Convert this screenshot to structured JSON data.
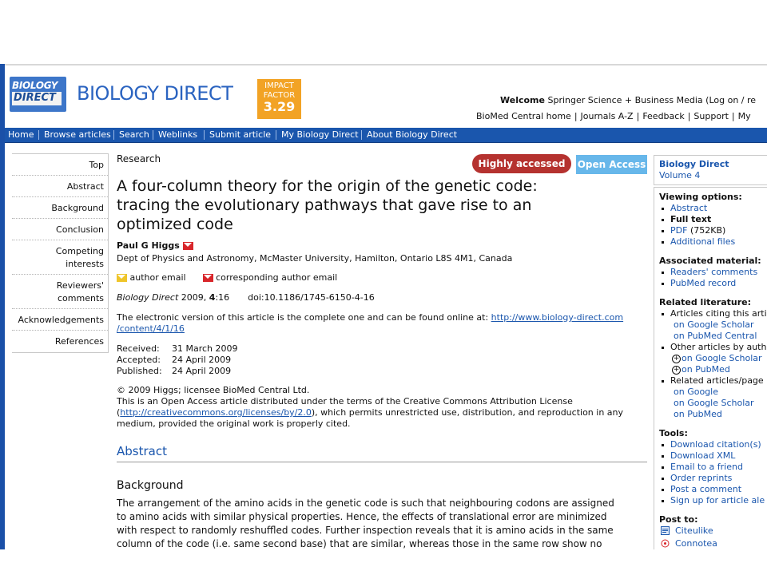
{
  "header": {
    "logo_line1": "BIOLOGY",
    "logo_line2": "DIRECT",
    "brand": "BIOLOGY DIRECT",
    "impact_line1": "IMPACT",
    "impact_line2": "FACTOR",
    "impact_value": "3.29",
    "welcome_label": "Welcome",
    "welcome_text": "Springer Science + Business Media (Log on / re",
    "top_links": [
      "BioMed Central home",
      "Journals A-Z",
      "Feedback",
      "Support",
      "My"
    ]
  },
  "navbar": [
    "Home",
    "Browse articles",
    "Search",
    "Weblinks",
    "Submit article",
    "My Biology Direct",
    "About Biology Direct"
  ],
  "leftnav": {
    "top": "Top",
    "abstract": "Abstract",
    "background": "Background",
    "conclusion": "Conclusion",
    "competing_1": "Competing",
    "competing_2": "interests",
    "reviewers_1": "Reviewers'",
    "reviewers_2": "comments",
    "acknowledgements": "Acknowledgements",
    "references": "References"
  },
  "article": {
    "type": "Research",
    "badge_highly": "Highly accessed",
    "badge_open": "Open Access",
    "title_l1": "A four-column theory for the origin of the genetic code:",
    "title_l2": "tracing the evolutionary pathways that gave rise to an",
    "title_l3": "optimized code",
    "author": "Paul G Higgs",
    "affiliation": "Dept of Physics and Astronomy, McMaster University, Hamilton, Ontario L8S 4M1, Canada",
    "author_email": "author email",
    "corresponding_email": "corresponding author email",
    "journal": "Biology Direct",
    "year": "2009,",
    "volume": "4",
    "article_no": ":16",
    "doi": "doi:10.1186/1745-6150-4-16",
    "electronic_text": "The electronic version of this article is the complete one and can be found online at: ",
    "electronic_url_1": "http://www.biology-direct.com",
    "electronic_url_2": "/content/4/1/16",
    "received_label": "Received:",
    "received": "31 March 2009",
    "accepted_label": "Accepted:",
    "accepted": "24 April 2009",
    "published_label": "Published:",
    "published": "24 April 2009",
    "copyright": "© 2009 Higgs; licensee BioMed Central Ltd.",
    "license_text_1": "This is an Open Access article distributed under the terms of the Creative Commons Attribution License",
    "license_open_paren": "(",
    "license_url": "http://creativecommons.org/licenses/by/2.0",
    "license_text_2": "), which permits unrestricted use, distribution, and reproduction in any",
    "license_text_3": "medium, provided the original work is properly cited.",
    "abstract_heading": "Abstract",
    "background_heading": "Background",
    "background_l1": "The arrangement of the amino acids in the genetic code is such that neighbouring codons are assigned",
    "background_l2": "to amino acids with similar physical properties. Hence, the effects of translational error are minimized",
    "background_l3": "with respect to randomly reshuffled codes. Further inspection reveals that it is amino acids in the same",
    "background_l4": "column of the code (i.e. same second base) that are similar, whereas those in the same row show no"
  },
  "right": {
    "journal": "Biology Direct",
    "volume": "Volume 4",
    "viewing_heading": "Viewing options:",
    "viewing": [
      "Abstract",
      "Full text",
      "PDF",
      "(752KB)",
      "Additional files"
    ],
    "associated_heading": "Associated material:",
    "associated": [
      "Readers' comments",
      "PubMed record"
    ],
    "related_heading": "Related literature:",
    "citing": "Articles citing this artic",
    "citing_sub": [
      "on Google Scholar",
      "on PubMed Central"
    ],
    "other_by_author": "Other articles by auth",
    "other_sub": [
      "on Google Scholar",
      "on PubMed"
    ],
    "related_pages": "Related articles/page",
    "related_sub": [
      "on Google",
      "on Google Scholar",
      "on PubMed"
    ],
    "tools_heading": "Tools:",
    "tools": [
      "Download citation(s)",
      "Download XML",
      "Email to a friend",
      "Order reprints",
      "Post a comment",
      "Sign up for article ale"
    ],
    "post_heading": "Post to:",
    "post": [
      "Citeulike",
      "Connotea"
    ]
  },
  "colors": {
    "brand_blue": "#2a63c0",
    "nav_blue": "#1a56ad",
    "impact_orange": "#f2a325",
    "highly_red": "#b5322f",
    "open_blue": "#67b7ea"
  }
}
